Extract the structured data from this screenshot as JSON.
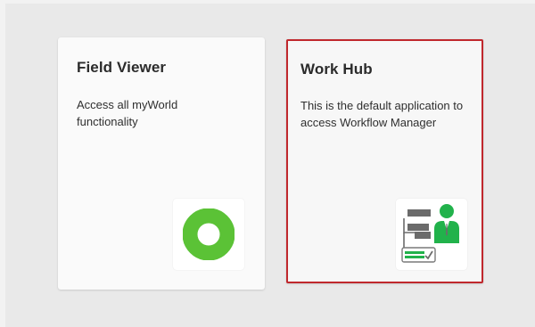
{
  "cards": [
    {
      "title": "Field Viewer",
      "description": "Access all myWorld functionality",
      "icon": "myworld-ring-icon"
    },
    {
      "title": "Work Hub",
      "description": "This is the default application to access Workflow Manager",
      "icon": "workflow-manager-icon",
      "selected": true
    }
  ],
  "colors": {
    "field_viewer_green": "#5bc236",
    "workflow_green": "#21b24b",
    "workflow_gray": "#6b6b6b",
    "selection_border": "#c0282d"
  }
}
